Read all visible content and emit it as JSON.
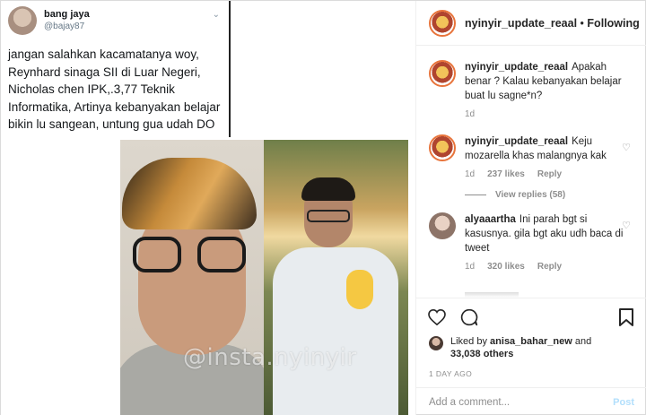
{
  "tweet": {
    "name": "bang jaya",
    "handle": "@bajay87",
    "text": "jangan salahkan kacamatanya woy, Reynhard sinaga SII di Luar Negeri, Nicholas chen IPK,.3,77 Teknik Informatika, Artinya kebanyakan belajar bikin lu sangean, untung gua udah DO"
  },
  "watermark": "@insta.nyinyir",
  "header": {
    "username": "nyinyir_update_reaal",
    "separator": "•",
    "following": "Following"
  },
  "comments": [
    {
      "username": "nyinyir_update_reaal",
      "text": "Apakah benar ? Kalau kebanyakan belajar buat lu sagne*n?",
      "time": "1d"
    },
    {
      "username": "nyinyir_update_reaal",
      "text": "Keju mozarella khas malangnya kak",
      "time": "1d",
      "likes": "237 likes",
      "reply": "Reply",
      "view_replies": "View replies (58)"
    },
    {
      "username": "alyaaartha",
      "text": "Ini parah bgt si kasusnya. gila bgt aku udh baca di tweet",
      "time": "1d",
      "likes": "320 likes",
      "reply": "Reply"
    }
  ],
  "icons": {
    "like": "heart-outline-icon",
    "comment": "speech-bubble-icon",
    "save": "bookmark-icon",
    "comment_like": "small-heart-icon"
  },
  "likes": {
    "prefix": "Liked by",
    "user": "anisa_bahar_new",
    "conjunction": "and",
    "others": "33,038 others"
  },
  "timestamp": "1 DAY AGO",
  "add_comment": {
    "placeholder": "Add a comment...",
    "post_label": "Post"
  },
  "colors": {
    "avatar_ring": "#e8743b",
    "post_button_disabled": "#b2dffc",
    "text": "#262626",
    "muted": "#8e8e8e"
  }
}
